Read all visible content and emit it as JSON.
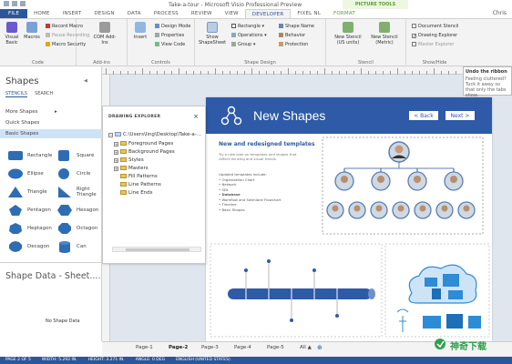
{
  "window": {
    "title": "Take-a-tour - Microsoft Visio Professional Preview",
    "context_tab_group": "PICTURE TOOLS",
    "user": "Chris"
  },
  "tabs": [
    "FILE",
    "HOME",
    "INSERT",
    "DESIGN",
    "DATA",
    "PROCESS",
    "REVIEW",
    "VIEW",
    "DEVELOPER",
    "FIXEL NL",
    "FORMAT"
  ],
  "ribbon": {
    "code": {
      "label": "Code",
      "visual_basic": "Visual Basic",
      "macros": "Macros",
      "record_macro": "Record Macro",
      "pause_recording": "Pause Recording",
      "macro_security": "Macro Security"
    },
    "addins": {
      "label": "Add-ins",
      "com_addins": "COM Add-Ins"
    },
    "controls": {
      "label": "Controls",
      "insert": "Insert",
      "design_mode": "Design Mode",
      "properties": "Properties",
      "view_code": "View Code"
    },
    "shape_design": {
      "label": "Shape Design",
      "show_shapesheet": "Show ShapeSheet",
      "rectangle": "Rectangle",
      "operations": "Operations",
      "group": "Group",
      "shape_name": "Shape Name",
      "behavior": "Behavior",
      "protection": "Protection"
    },
    "stencil": {
      "label": "Stencil",
      "new_us": "New Stencil (US units)",
      "new_metric": "New Stencil (Metric)"
    },
    "show_hide": {
      "label": "Show/Hide",
      "document_stencil": "Document Stencil",
      "drawing_explorer": "Drawing Explorer",
      "master_explorer": "Master Explorer"
    }
  },
  "tooltip": {
    "title": "Undo the ribbon",
    "text": "Feeling cluttered? Tuck it away so that only the tabs show."
  },
  "shapes_panel": {
    "title": "Shapes",
    "tabs": [
      "STENCILS",
      "SEARCH"
    ],
    "more_shapes": "More Shapes",
    "quick_shapes": "Quick Shapes",
    "basic_shapes": "Basic Shapes",
    "shapes": [
      "Rectangle",
      "Square",
      "Ellipse",
      "Circle",
      "Triangle",
      "Right Triangle",
      "Pentagon",
      "Hexagon",
      "Heptagon",
      "Octagon",
      "Decagon",
      "Can"
    ]
  },
  "shape_data": {
    "title": "Shape Data - Sheet....",
    "empty": "No Shape Data"
  },
  "drawing_explorer": {
    "title": "DRAWING EXPLORER",
    "root": "C:\\Users\\ling\\Desktop\\Take-a-...",
    "items": [
      "Foreground Pages",
      "Background Pages",
      "Styles",
      "Masters",
      "Fill Patterns",
      "Line Patterns",
      "Line Ends"
    ]
  },
  "slide": {
    "title": "New Shapes",
    "back": "< Back",
    "next": "Next >",
    "subtitle": "New and redesigned templates",
    "para": "Try a new look on templates and shapes that reflect thinking and visual trends.",
    "list_head": "Updated templates include:",
    "list": [
      "Organization Chart",
      "Network",
      "SDL",
      "Database",
      "Workflow and Swimlane Flowchart",
      "Timeline",
      "Basic Shapes"
    ]
  },
  "pages": [
    "Page-1",
    "Page-2",
    "Page-3",
    "Page-4",
    "Page-5",
    "All ▲"
  ],
  "status": [
    "PAGE 2 OF 5",
    "WIDTH: 5.292 IN.",
    "HEIGHT: 3.271 IN.",
    "ANGLE: 0 DEG",
    "ENGLISH (UNITED STATES)"
  ],
  "watermark": "神奇下载",
  "colors": {
    "accent": "#2b579a",
    "slide_header": "#2e5aa8",
    "picture_tools": "#5a9a3a"
  }
}
